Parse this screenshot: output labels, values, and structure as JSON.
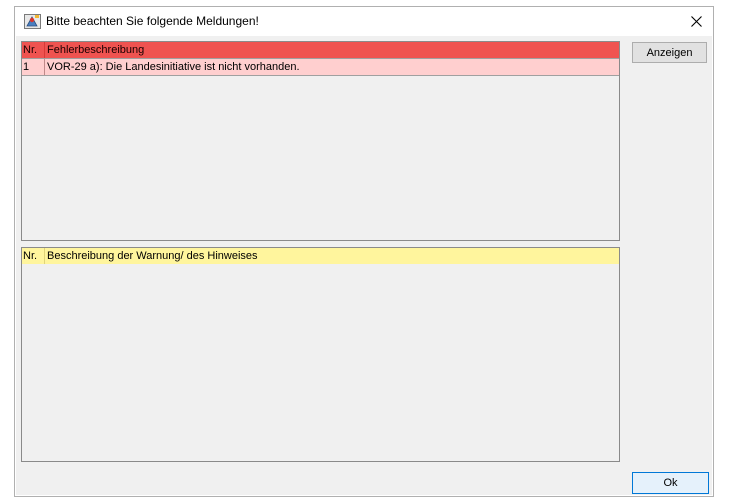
{
  "window": {
    "title": "Bitte beachten Sie folgende Meldungen!"
  },
  "errors": {
    "columns": {
      "nr": "Nr.",
      "desc": "Fehlerbeschreibung"
    },
    "rows": [
      {
        "nr": "1",
        "desc": "VOR-29 a): Die Landesinitiative ist nicht vorhanden."
      }
    ]
  },
  "warnings": {
    "columns": {
      "nr": "Nr.",
      "desc": "Beschreibung der Warnung/ des Hinweises"
    },
    "rows": []
  },
  "buttons": {
    "show": "Anzeigen",
    "ok": "Ok"
  },
  "colors": {
    "error_header": "#ef5350",
    "error_row": "#ffcfcf",
    "warning_header": "#fff59d",
    "background": "#f0f0f0"
  },
  "icons": {
    "app": "java-app-icon",
    "close": "close-icon"
  }
}
